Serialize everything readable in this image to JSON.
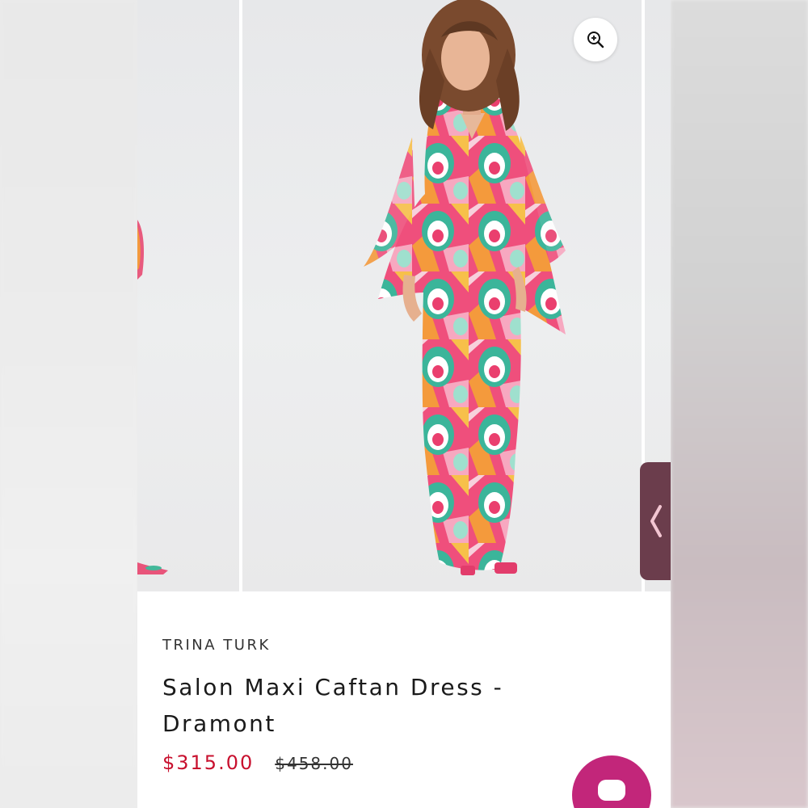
{
  "product": {
    "brand": "TRINA TURK",
    "title": "Salon Maxi Caftan Dress - Dramont",
    "sale_price": "$315.00",
    "original_price": "$458.00"
  },
  "gallery": {
    "zoom_icon": "zoom-in-icon",
    "prev_icon": "chevron-left-icon",
    "accent_color": "#6b3d4c"
  },
  "chat": {
    "icon": "chat-bubble-icon",
    "color": "#c2267a"
  },
  "colors": {
    "sale_price": "#c8102e"
  }
}
